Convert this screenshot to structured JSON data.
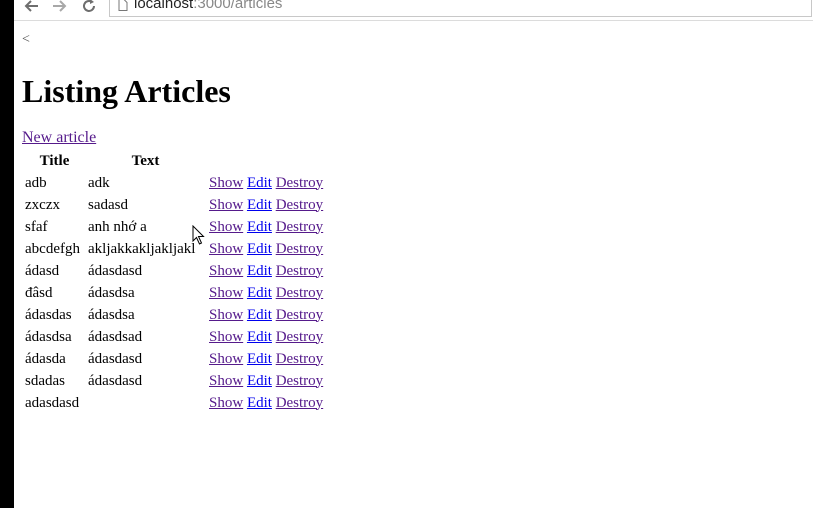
{
  "browser": {
    "url_host": "localhost",
    "url_rest": ":3000/articles"
  },
  "page": {
    "back_link": "<",
    "heading": "Listing Articles",
    "new_article_link": "New article"
  },
  "table": {
    "headers": [
      "Title",
      "Text"
    ],
    "actions": {
      "show": "Show",
      "edit": "Edit",
      "destroy": "Destroy"
    },
    "rows": [
      {
        "title": "adb",
        "text": "adk"
      },
      {
        "title": "zxczx",
        "text": "sadasd"
      },
      {
        "title": "sfaf",
        "text": "anh nhớ a"
      },
      {
        "title": "abcdefgh",
        "text": "akljakkakljakljakl"
      },
      {
        "title": "ádasd",
        "text": "ádasdasd"
      },
      {
        "title": "đâsd",
        "text": "ádasdsa"
      },
      {
        "title": "ádasdas",
        "text": "ádasdsa"
      },
      {
        "title": "ádasdsa",
        "text": "ádasdsad"
      },
      {
        "title": "ádasda",
        "text": "ádasdasd"
      },
      {
        "title": "sdadas",
        "text": "ádasdasd"
      },
      {
        "title": "adasdasd",
        "text": ""
      }
    ]
  },
  "colors": {
    "link_visited": "#551a8b",
    "link_unvisited": "#0000ee",
    "left_strip": "#000000"
  }
}
